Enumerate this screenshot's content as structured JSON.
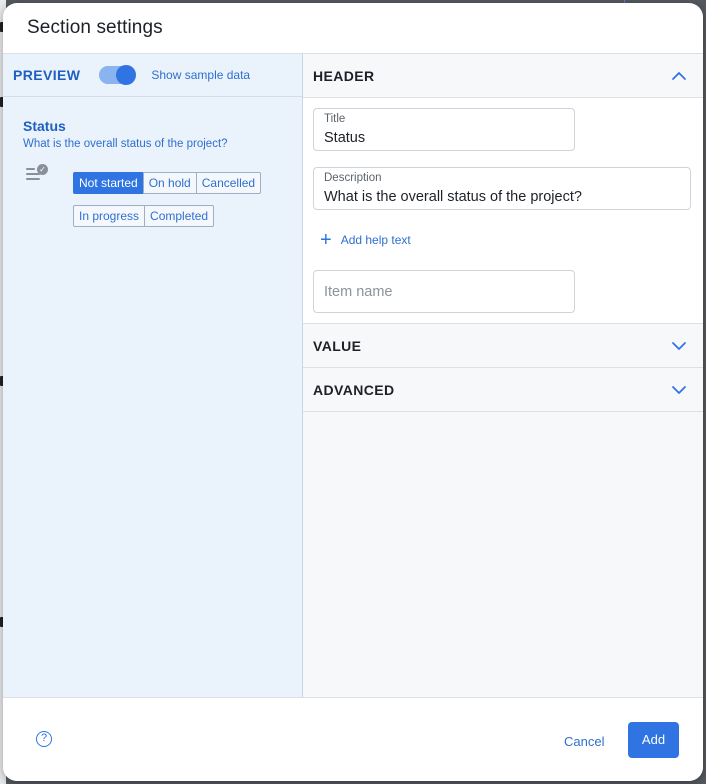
{
  "modal": {
    "title": "Section settings"
  },
  "preview": {
    "label": "PREVIEW",
    "toggle_on": true,
    "toggle_label": "Show sample data",
    "question_title": "Status",
    "question_desc": "What is the overall status of the project?",
    "options_row1": [
      "Not started",
      "On hold",
      "Cancelled"
    ],
    "options_row2": [
      "In progress",
      "Completed"
    ],
    "selected_option": "Not started"
  },
  "settings": {
    "header": {
      "label": "HEADER",
      "expanded": true,
      "title_label": "Title",
      "title_value": "Status",
      "description_label": "Description",
      "description_value": "What is the overall status of the project?",
      "help_link": "Add help text",
      "item_name_placeholder": "Item name"
    },
    "value": {
      "label": "VALUE",
      "expanded": false
    },
    "advanced": {
      "label": "ADVANCED",
      "expanded": false
    }
  },
  "footer": {
    "help_icon": "question-circle-icon",
    "cancel": "Cancel",
    "add": "Add"
  },
  "colors": {
    "accent": "#2f74e2",
    "preview_bg": "#eaf2fc",
    "text_dark": "#1d2127"
  }
}
